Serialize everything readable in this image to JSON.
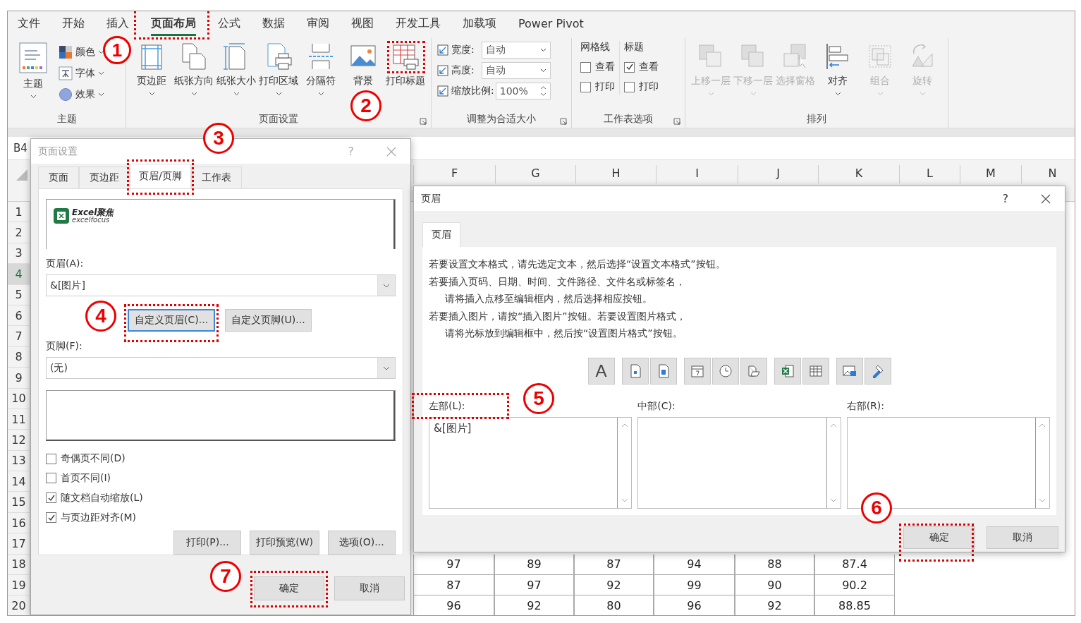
{
  "ribbon": {
    "tabs": [
      {
        "label": "文件",
        "selected": false
      },
      {
        "label": "开始",
        "selected": false
      },
      {
        "label": "插入",
        "selected": false
      },
      {
        "label": "页面布局",
        "selected": true,
        "callout": "1"
      },
      {
        "label": "公式",
        "selected": false
      },
      {
        "label": "数据",
        "selected": false
      },
      {
        "label": "审阅",
        "selected": false
      },
      {
        "label": "视图",
        "selected": false
      },
      {
        "label": "开发工具",
        "selected": false
      },
      {
        "label": "加载项",
        "selected": false
      },
      {
        "label": "Power Pivot",
        "selected": false
      }
    ],
    "groups": [
      {
        "kind": "theme",
        "label": "主题",
        "launcher": false,
        "main": "主题",
        "items": [
          {
            "label": "颜色"
          },
          {
            "label": "字体"
          },
          {
            "label": "效果"
          }
        ]
      },
      {
        "kind": "page-setup",
        "label": "页面设置",
        "launcher": true,
        "buttons": [
          {
            "label": "页边距",
            "disabled": false,
            "menu": true
          },
          {
            "label": "纸张方向",
            "disabled": false,
            "menu": true
          },
          {
            "label": "纸张大小",
            "disabled": false,
            "menu": true
          },
          {
            "label": "打印区域",
            "disabled": false,
            "menu": true
          },
          {
            "label": "分隔符",
            "disabled": false,
            "menu": true
          },
          {
            "label": "背景",
            "disabled": false,
            "menu": false
          },
          {
            "label": "打印标题",
            "disabled": false,
            "menu": false,
            "callout": "2"
          }
        ]
      },
      {
        "kind": "scale",
        "label": "调整为合适大小",
        "launcher": true,
        "fields": [
          {
            "label": "宽度:",
            "value": "自动",
            "kind": "dropdown"
          },
          {
            "label": "高度:",
            "value": "自动",
            "kind": "dropdown"
          },
          {
            "label": "缩放比例:",
            "value": "100%",
            "kind": "spinner"
          }
        ]
      },
      {
        "kind": "options",
        "label": "工作表选项",
        "launcher": true,
        "columns": [
          {
            "title": "网格线",
            "checks": [
              {
                "label": "查看",
                "checked": false
              },
              {
                "label": "打印",
                "checked": false
              }
            ]
          },
          {
            "title": "标题",
            "checks": [
              {
                "label": "查看",
                "checked": true
              },
              {
                "label": "打印",
                "checked": false
              }
            ]
          }
        ]
      },
      {
        "kind": "arrange",
        "label": "排列",
        "launcher": false,
        "buttons": [
          {
            "label": "上移一层",
            "disabled": true,
            "menu": true
          },
          {
            "label": "下移一层",
            "disabled": true,
            "menu": true
          },
          {
            "label": "选择窗格",
            "disabled": true,
            "menu": false
          },
          {
            "label": "对齐",
            "disabled": false,
            "menu": true
          },
          {
            "label": "组合",
            "disabled": true,
            "menu": true
          },
          {
            "label": "旋转",
            "disabled": true,
            "menu": true
          }
        ]
      }
    ]
  },
  "sheet": {
    "name_box": "B4",
    "columns": [
      "F",
      "G",
      "H",
      "I",
      "J",
      "K",
      "L",
      "M",
      "N"
    ],
    "rows": [
      {
        "number": "1",
        "selected": false
      },
      {
        "number": "2",
        "selected": false
      },
      {
        "number": "3",
        "selected": false
      },
      {
        "number": "4",
        "selected": true
      },
      {
        "number": "5",
        "selected": false
      },
      {
        "number": "6",
        "selected": false
      },
      {
        "number": "7",
        "selected": false
      },
      {
        "number": "8",
        "selected": false
      },
      {
        "number": "9",
        "selected": false
      },
      {
        "number": "10",
        "selected": false
      },
      {
        "number": "11",
        "selected": false
      },
      {
        "number": "12",
        "selected": false
      },
      {
        "number": "13",
        "selected": false
      },
      {
        "number": "14",
        "selected": false
      },
      {
        "number": "15",
        "selected": false
      },
      {
        "number": "16",
        "selected": false
      },
      {
        "number": "17",
        "selected": false
      },
      {
        "number": "18",
        "selected": false,
        "cells": [
          "97",
          "89",
          "87",
          "94",
          "88",
          "87.4"
        ]
      },
      {
        "number": "19",
        "selected": false,
        "cells": [
          "87",
          "97",
          "92",
          "99",
          "90",
          "90.2"
        ]
      },
      {
        "number": "20",
        "selected": false,
        "cells": [
          "96",
          "92",
          "80",
          "96",
          "92",
          "88.85"
        ]
      }
    ]
  },
  "page_setup_dialog": {
    "title": "页面设置",
    "help": "?",
    "tabs": [
      {
        "label": "页面",
        "selected": false
      },
      {
        "label": "页边距",
        "selected": false
      },
      {
        "label": "页眉/页脚",
        "selected": true,
        "callout": "3"
      },
      {
        "label": "工作表",
        "selected": false
      }
    ],
    "logo": {
      "title": "Excel聚焦",
      "subtitle": "excelfocus"
    },
    "header_label": "页眉(A):",
    "header_value": "&[图片]",
    "custom_buttons": [
      {
        "label": "自定义页眉(C)...",
        "focused": true,
        "callout": "4"
      },
      {
        "label": "自定义页脚(U)...",
        "focused": false
      }
    ],
    "footer_label": "页脚(F):",
    "footer_value": "(无)",
    "checks": [
      {
        "label": "奇偶页不同(D)",
        "checked": false
      },
      {
        "label": "首页不同(I)",
        "checked": false
      },
      {
        "label": "随文档自动缩放(L)",
        "checked": true
      },
      {
        "label": "与页边距对齐(M)",
        "checked": true
      }
    ],
    "panel_buttons": [
      "打印(P)...",
      "打印预览(W)",
      "选项(O)..."
    ],
    "ok": {
      "label": "确定",
      "callout": "7"
    },
    "cancel": "取消"
  },
  "header_dialog": {
    "title": "页眉",
    "help": "?",
    "tab": "页眉",
    "instructions": [
      {
        "text": "若要设置文本格式，请先选定文本，然后选择“设置文本格式”按钮。",
        "indent": false
      },
      {
        "text": "若要插入页码、日期、时间、文件路径、文件名或标签名，",
        "indent": false
      },
      {
        "text": "请将插入点移至编辑框内，然后选择相应按钮。",
        "indent": true
      },
      {
        "text": "若要插入图片，请按“插入图片”按钮。若要设置图片格式，",
        "indent": false
      },
      {
        "text": "请将光标放到编辑框中，然后按“设置图片格式”按钮。",
        "indent": true
      }
    ],
    "toolbar": [
      [
        {
          "kind": "letter",
          "text": "A"
        }
      ],
      [
        {
          "kind": "page-number"
        },
        {
          "kind": "page-count"
        }
      ],
      [
        {
          "kind": "date"
        },
        {
          "kind": "time"
        },
        {
          "kind": "file-path"
        }
      ],
      [
        {
          "kind": "excel-file"
        },
        {
          "kind": "sheet"
        }
      ],
      [
        {
          "kind": "picture"
        },
        {
          "kind": "format-picture"
        }
      ]
    ],
    "sections": [
      {
        "label": "左部(L):",
        "value": "&[图片]",
        "callout": "5"
      },
      {
        "label": "中部(C):"
      },
      {
        "label": "右部(R):"
      }
    ],
    "ok": {
      "label": "确定",
      "callout": "6"
    },
    "cancel": "取消"
  }
}
